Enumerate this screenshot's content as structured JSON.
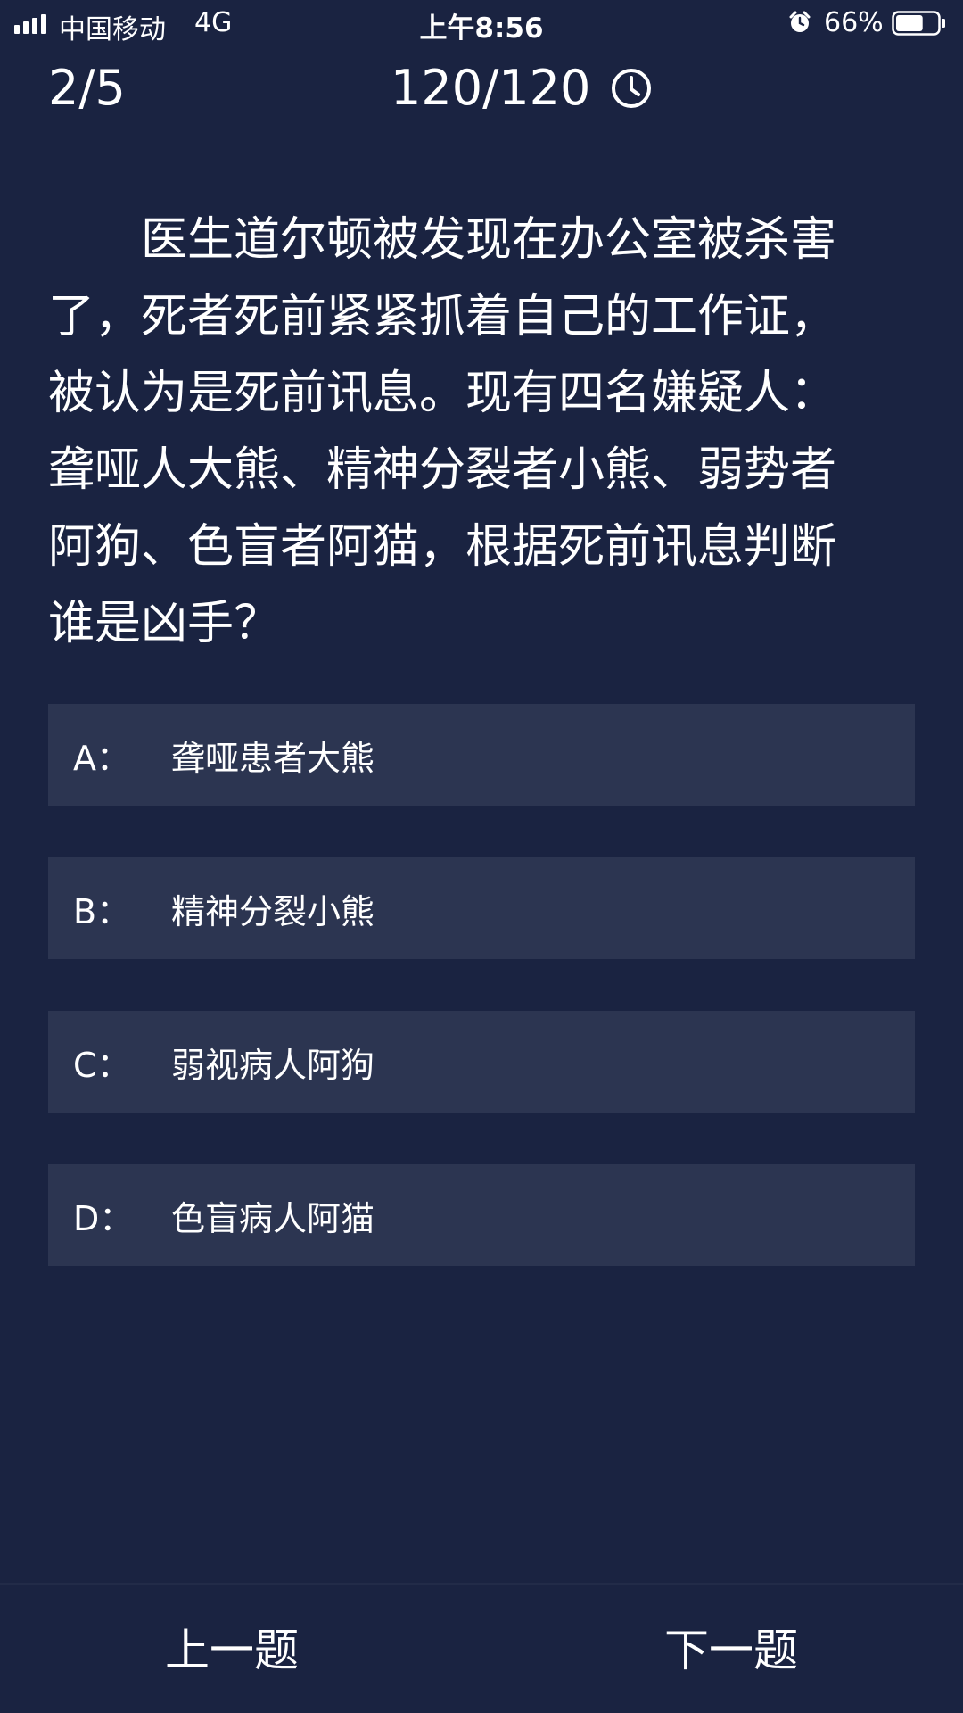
{
  "status_bar": {
    "carrier": "中国移动",
    "network": "4G",
    "time": "上午8:56",
    "battery_percent": "66%",
    "battery_level": 0.66,
    "icons": [
      "signal-icon",
      "alarm-icon",
      "battery-icon"
    ]
  },
  "header": {
    "progress": "2/5",
    "timer": "120/120",
    "timer_icon": "clock-icon"
  },
  "question": {
    "text": "医生道尔顿被发现在办公室被杀害了，死者死前紧紧抓着自己的工作证，被认为是死前讯息。现有四名嫌疑人：聋哑人大熊、精神分裂者小熊、弱势者阿狗、色盲者阿猫，根据死前讯息判断谁是凶手？"
  },
  "options": [
    {
      "letter": "A：",
      "text": "聋哑患者大熊"
    },
    {
      "letter": "B：",
      "text": "精神分裂小熊"
    },
    {
      "letter": "C：",
      "text": "弱视病人阿狗"
    },
    {
      "letter": "D：",
      "text": "色盲病人阿猫"
    }
  ],
  "nav": {
    "prev_label": "上一题",
    "next_label": "下一题"
  },
  "colors": {
    "background": "#1a2341",
    "option_background": "#2c3551",
    "text": "#ffffff"
  }
}
